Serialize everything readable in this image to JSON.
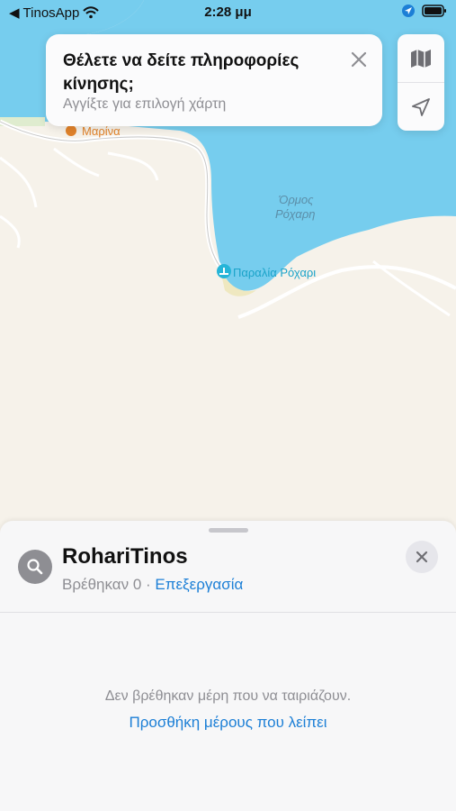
{
  "status_bar": {
    "back_app": "TinosApp",
    "time": "2:28 μμ"
  },
  "traffic_prompt": {
    "title": "Θέλετε να δείτε πληροφορίες κίνησης;",
    "subtitle": "Αγγίξτε για επιλογή χάρτη"
  },
  "map": {
    "labels": {
      "marina": "Μαρίνα",
      "bay_line1": "Όρμος",
      "bay_line2": "Ρόχαρη",
      "beach": "Παραλία Ρόχαρι"
    },
    "colors": {
      "water": "#76cdee",
      "land": "#f6f2ea",
      "poi_orange": "#e0822a",
      "poi_teal": "#26b5d8"
    }
  },
  "map_controls": {
    "buttons": [
      "map-icon",
      "location-arrow-icon"
    ]
  },
  "search_sheet": {
    "query": "RohariTinos",
    "found_count": "Βρέθηκαν 0",
    "separator": " · ",
    "edit_label": "Επεξεργασία",
    "empty_message": "Δεν βρέθηκαν μέρη που να ταιριάζουν.",
    "add_missing_label": "Προσθήκη μέρους που λείπει"
  }
}
